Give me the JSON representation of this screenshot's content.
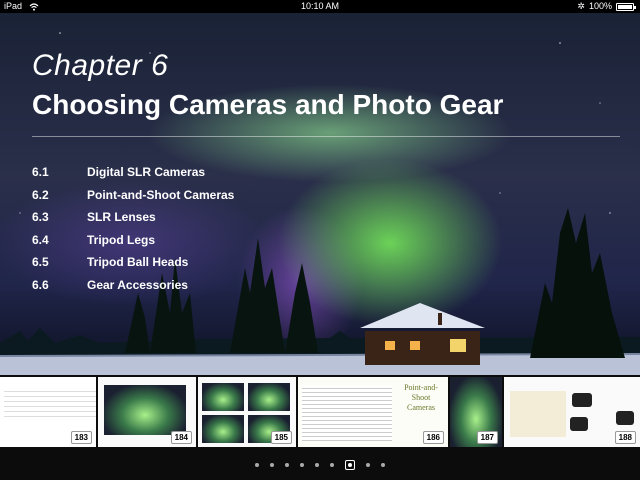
{
  "status_bar": {
    "device": "iPad",
    "time": "10:10 AM",
    "battery": "100%"
  },
  "chapter": {
    "label": "Chapter 6",
    "title": "Choosing Cameras and Photo Gear",
    "toc": [
      {
        "num": "6.1",
        "title": "Digital SLR Cameras"
      },
      {
        "num": "6.2",
        "title": "Point-and-Shoot Cameras"
      },
      {
        "num": "6.3",
        "title": "SLR Lenses"
      },
      {
        "num": "6.4",
        "title": "Tripod Legs"
      },
      {
        "num": "6.5",
        "title": "Tripod Ball Heads"
      },
      {
        "num": "6.6",
        "title": "Gear Accessories"
      }
    ]
  },
  "thumbnails": [
    {
      "page": "183"
    },
    {
      "page": "184"
    },
    {
      "page": "185"
    },
    {
      "page": "186",
      "heading": "Point-and-Shoot Cameras"
    },
    {
      "page": "187"
    },
    {
      "page": "188"
    }
  ],
  "pager": {
    "dot_count": 9,
    "active_index": 6
  },
  "colors": {
    "background": "#000000",
    "strip": "#0c0c0c"
  }
}
